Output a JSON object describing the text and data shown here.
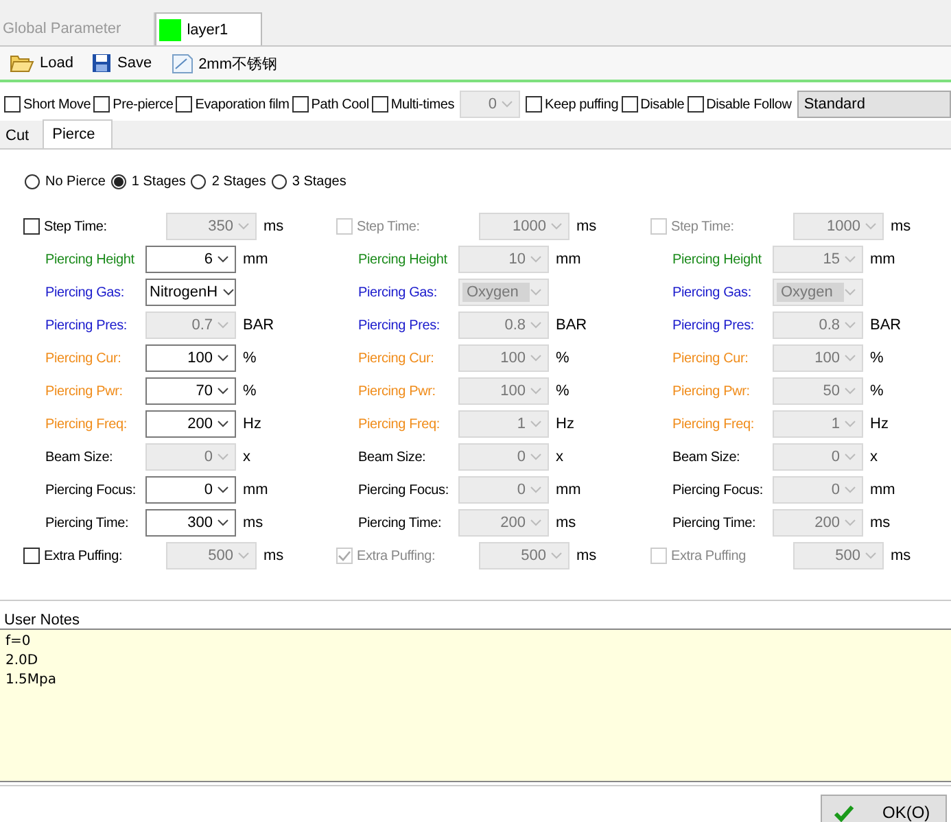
{
  "tabs": [
    {
      "label": "Global Parameter",
      "selected": false
    },
    {
      "label": "layer1",
      "selected": true,
      "color": "#00ff00"
    }
  ],
  "toolbar": [
    {
      "label": "Load"
    },
    {
      "label": "Save"
    },
    {
      "label": "2mm不锈钢"
    }
  ],
  "options": [
    {
      "kind": "checkbox",
      "label": "Short Move",
      "checked": false
    },
    {
      "kind": "checkbox",
      "label": "Pre-pierce",
      "checked": false
    },
    {
      "kind": "checkbox",
      "label": "Evaporation film",
      "checked": false
    },
    {
      "kind": "checkbox",
      "label": "Path Cool",
      "checked": false
    },
    {
      "kind": "checkbox",
      "label": "Multi-times",
      "checked": false
    },
    {
      "kind": "combo",
      "value": "0",
      "disabled": true
    },
    {
      "kind": "checkbox",
      "label": "Keep puffing",
      "checked": false
    },
    {
      "kind": "checkbox",
      "label": "Disable",
      "checked": false
    },
    {
      "kind": "checkbox",
      "label": "Disable Follow",
      "checked": false
    },
    {
      "kind": "select",
      "value": "Standard"
    }
  ],
  "subtabs": [
    {
      "label": "Cut",
      "selected": false
    },
    {
      "label": "Pierce",
      "selected": true
    }
  ],
  "pierce_modes": [
    {
      "label": "No Pierce",
      "selected": false
    },
    {
      "label": "1 Stages",
      "selected": true
    },
    {
      "label": "2 Stages",
      "selected": false
    },
    {
      "label": "3 Stages",
      "selected": false
    }
  ],
  "stages": [
    {
      "rows": [
        {
          "kind": "check",
          "label": "Step Time:",
          "checked": false,
          "check_disabled": false,
          "value": "350",
          "unit": "ms",
          "color": "#000000",
          "disabled": true
        },
        {
          "kind": "combo",
          "label": "Piercing Height",
          "value": "6",
          "unit": "mm",
          "color": "#1a8a1a",
          "disabled": false
        },
        {
          "kind": "select",
          "label": "Piercing Gas:",
          "value": "NitrogenH",
          "color": "#1a1acc",
          "disabled": false
        },
        {
          "kind": "combo",
          "label": "Piercing Pres:",
          "value": "0.7",
          "unit": "BAR",
          "color": "#1a1acc",
          "disabled": true
        },
        {
          "kind": "combo",
          "label": "Piercing Cur:",
          "value": "100",
          "unit": "%",
          "color": "#f08c1a",
          "disabled": false
        },
        {
          "kind": "combo",
          "label": "Piercing Pwr:",
          "value": "70",
          "unit": "%",
          "color": "#f08c1a",
          "disabled": false
        },
        {
          "kind": "combo",
          "label": "Piercing Freq:",
          "value": "200",
          "unit": "Hz",
          "color": "#f08c1a",
          "disabled": false
        },
        {
          "kind": "combo",
          "label": "Beam Size:",
          "value": "0",
          "unit": "x",
          "color": "#000000",
          "disabled": true
        },
        {
          "kind": "combo",
          "label": "Piercing Focus:",
          "value": "0",
          "unit": "mm",
          "color": "#000000",
          "disabled": false
        },
        {
          "kind": "combo",
          "label": "Piercing Time:",
          "value": "300",
          "unit": "ms",
          "color": "#000000",
          "disabled": false
        },
        {
          "kind": "check",
          "label": "Extra Puffing:",
          "checked": false,
          "check_disabled": false,
          "value": "500",
          "unit": "ms",
          "color": "#000000",
          "disabled": true
        }
      ]
    },
    {
      "rows": [
        {
          "kind": "check",
          "label": "Step Time:",
          "checked": false,
          "check_disabled": true,
          "value": "1000",
          "unit": "ms",
          "color": "#888888",
          "disabled": true
        },
        {
          "kind": "combo",
          "label": "Piercing Height",
          "value": "10",
          "unit": "mm",
          "color": "#1a8a1a",
          "disabled": true
        },
        {
          "kind": "select",
          "label": "Piercing Gas:",
          "value": "Oxygen",
          "color": "#1a1acc",
          "disabled": true
        },
        {
          "kind": "combo",
          "label": "Piercing Pres:",
          "value": "0.8",
          "unit": "BAR",
          "color": "#1a1acc",
          "disabled": true
        },
        {
          "kind": "combo",
          "label": "Piercing Cur:",
          "value": "100",
          "unit": "%",
          "color": "#f08c1a",
          "disabled": true
        },
        {
          "kind": "combo",
          "label": "Piercing Pwr:",
          "value": "100",
          "unit": "%",
          "color": "#f08c1a",
          "disabled": true
        },
        {
          "kind": "combo",
          "label": "Piercing Freq:",
          "value": "1",
          "unit": "Hz",
          "color": "#f08c1a",
          "disabled": true
        },
        {
          "kind": "combo",
          "label": "Beam Size:",
          "value": "0",
          "unit": "x",
          "color": "#000000",
          "disabled": true
        },
        {
          "kind": "combo",
          "label": "Piercing Focus:",
          "value": "0",
          "unit": "mm",
          "color": "#000000",
          "disabled": true
        },
        {
          "kind": "combo",
          "label": "Piercing Time:",
          "value": "200",
          "unit": "ms",
          "color": "#000000",
          "disabled": true
        },
        {
          "kind": "check",
          "label": "Extra Puffing:",
          "checked": true,
          "check_disabled": true,
          "value": "500",
          "unit": "ms",
          "color": "#888888",
          "disabled": true
        }
      ]
    },
    {
      "rows": [
        {
          "kind": "check",
          "label": "Step Time:",
          "checked": false,
          "check_disabled": true,
          "value": "1000",
          "unit": "ms",
          "color": "#888888",
          "disabled": true
        },
        {
          "kind": "combo",
          "label": "Piercing Height",
          "value": "15",
          "unit": "mm",
          "color": "#1a8a1a",
          "disabled": true
        },
        {
          "kind": "select",
          "label": "Piercing Gas:",
          "value": "Oxygen",
          "color": "#1a1acc",
          "disabled": true
        },
        {
          "kind": "combo",
          "label": "Piercing Pres:",
          "value": "0.8",
          "unit": "BAR",
          "color": "#1a1acc",
          "disabled": true
        },
        {
          "kind": "combo",
          "label": "Piercing Cur:",
          "value": "100",
          "unit": "%",
          "color": "#f08c1a",
          "disabled": true
        },
        {
          "kind": "combo",
          "label": "Piercing Pwr:",
          "value": "50",
          "unit": "%",
          "color": "#f08c1a",
          "disabled": true
        },
        {
          "kind": "combo",
          "label": "Piercing Freq:",
          "value": "1",
          "unit": "Hz",
          "color": "#f08c1a",
          "disabled": true
        },
        {
          "kind": "combo",
          "label": "Beam Size:",
          "value": "0",
          "unit": "x",
          "color": "#000000",
          "disabled": true
        },
        {
          "kind": "combo",
          "label": "Piercing Focus:",
          "value": "0",
          "unit": "mm",
          "color": "#000000",
          "disabled": true
        },
        {
          "kind": "combo",
          "label": "Piercing Time:",
          "value": "200",
          "unit": "ms",
          "color": "#000000",
          "disabled": true
        },
        {
          "kind": "check",
          "label": "Extra Puffing",
          "checked": false,
          "check_disabled": true,
          "value": "500",
          "unit": "ms",
          "color": "#888888",
          "disabled": true
        }
      ]
    }
  ],
  "notes": {
    "label": "User Notes",
    "value": "f=0\n2.0D\n1.5Mpa"
  },
  "ok_button": "OK(O)"
}
